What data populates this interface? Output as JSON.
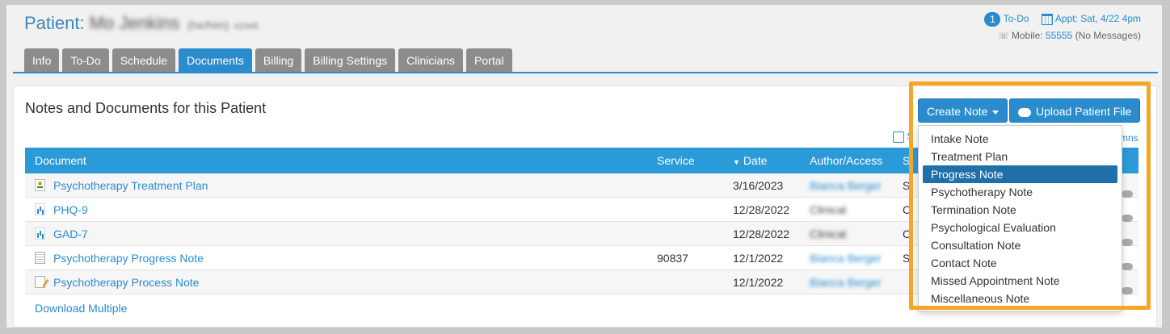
{
  "header": {
    "title_prefix": "Patient:",
    "patient_name": "Mo Jenkins",
    "pronouns": "(he/him)",
    "patient_id": "#2345",
    "todo_count": "1",
    "todo_label": "To-Do",
    "appt_label": "Appt: Sat, 4/22 4pm",
    "mobile_label": "Mobile:",
    "mobile_number": "55555",
    "mobile_note": "(No Messages)"
  },
  "tabs": [
    "Info",
    "To-Do",
    "Schedule",
    "Documents",
    "Billing",
    "Billing Settings",
    "Clinicians",
    "Portal"
  ],
  "active_tab": "Documents",
  "panel": {
    "heading": "Notes and Documents for this Patient",
    "partial_link_left": "S",
    "partial_link_right": "mns",
    "download_multiple": "Download Multiple"
  },
  "table": {
    "columns": {
      "document": "Document",
      "service": "Service",
      "date": "Date",
      "author": "Author/Access",
      "status": "St"
    },
    "rows": [
      {
        "icon": "treatment-plan-icon",
        "document": "Psychotherapy Treatment Plan",
        "service": "",
        "date": "3/16/2023",
        "author": "Bianca Berger",
        "author_link": true,
        "status": "Si"
      },
      {
        "icon": "bar-chart-icon",
        "document": "PHQ-9",
        "service": "",
        "date": "12/28/2022",
        "author": "Clinical",
        "author_link": false,
        "status": "C"
      },
      {
        "icon": "bar-chart-icon",
        "document": "GAD-7",
        "service": "",
        "date": "12/28/2022",
        "author": "Clinical",
        "author_link": false,
        "status": "C"
      },
      {
        "icon": "note-icon",
        "document": "Psychotherapy Progress Note",
        "service": "90837",
        "date": "12/1/2022",
        "author": "Bianca Berger",
        "author_link": true,
        "status": "Si"
      },
      {
        "icon": "process-note-icon",
        "document": "Psychotherapy Process Note",
        "service": "",
        "date": "12/1/2022",
        "author": "Bianca Berger",
        "author_link": true,
        "status": ""
      }
    ]
  },
  "buttons": {
    "create_note": "Create Note",
    "upload_file": "Upload Patient File"
  },
  "create_note_menu": {
    "items": [
      "Intake Note",
      "Treatment Plan",
      "Progress Note",
      "Psychotherapy Note",
      "Termination Note",
      "Psychological Evaluation",
      "Consultation Note",
      "Contact Note",
      "Missed Appointment Note",
      "Miscellaneous Note"
    ],
    "highlighted": "Progress Note"
  },
  "colors": {
    "accent": "#2a8ccd",
    "tab_inactive": "#8c8c8c",
    "highlight_frame": "#f5a623",
    "menu_highlight": "#1f6fa8"
  }
}
